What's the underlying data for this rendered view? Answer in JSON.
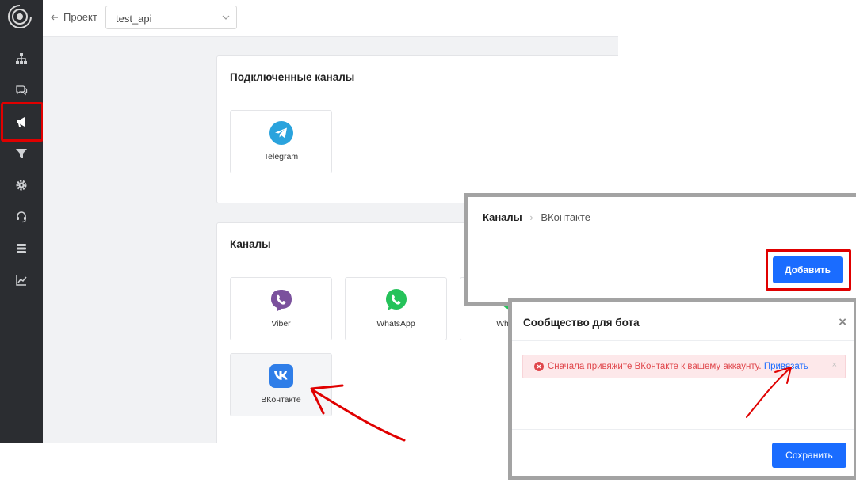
{
  "sidebar": {
    "items": [
      {
        "icon": "sitemap-icon"
      },
      {
        "icon": "chat-icon"
      },
      {
        "icon": "megaphone-icon"
      },
      {
        "icon": "filter-icon"
      },
      {
        "icon": "gear-icon"
      },
      {
        "icon": "headset-icon"
      },
      {
        "icon": "database-icon"
      },
      {
        "icon": "chart-icon"
      }
    ],
    "highlight_color": "#e00000"
  },
  "topbar": {
    "back_label": "Проект",
    "project_value": "test_api"
  },
  "connected": {
    "title": "Подключенные каналы",
    "tiles": [
      {
        "label": "Telegram",
        "icon": "telegram-icon"
      }
    ]
  },
  "channels": {
    "title": "Каналы",
    "tiles": [
      {
        "label": "Viber",
        "icon": "viber-icon"
      },
      {
        "label": "WhatsApp",
        "icon": "whatsapp-icon"
      },
      {
        "label": "WhatsA",
        "icon": "whatsapp-icon"
      },
      {
        "label": "ВКонтакте",
        "icon": "vk-icon"
      }
    ]
  },
  "vk_panel": {
    "breadcrumb_root": "Каналы",
    "breadcrumb_current": "ВКонтакте",
    "add_label": "Добавить"
  },
  "modal": {
    "title": "Сообщество для бота",
    "alert_text": "Сначала привяжите ВКонтакте к вашему аккаунту.",
    "alert_link": "Привязать",
    "save_label": "Сохранить"
  },
  "colors": {
    "primary": "#1a6cff",
    "error": "#e0474c",
    "sidebar": "#2b2d31",
    "annotation": "#e00000"
  }
}
